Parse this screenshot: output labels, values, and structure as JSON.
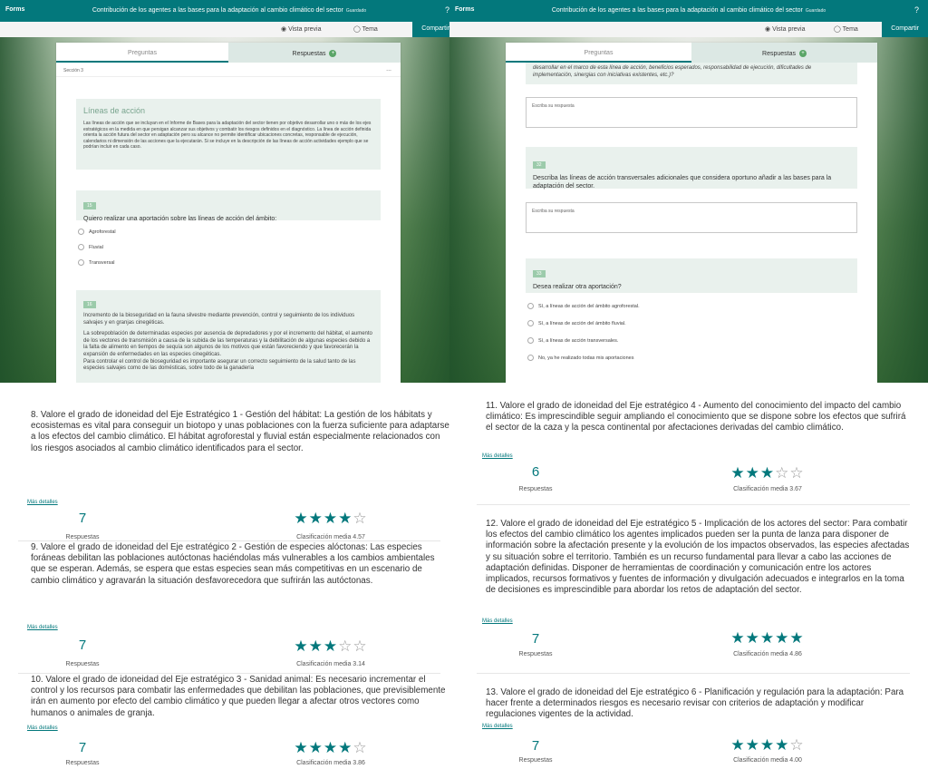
{
  "left_pane": {
    "topbar": {
      "brand": "Forms",
      "title": "Contribución de los agentes a las bases para la adaptación al cambio climático del sector",
      "status": "Guardado",
      "help": "?"
    },
    "subbar": {
      "preview": "Vista previa",
      "theme": "Tema",
      "share": "Compartir"
    },
    "tabs": {
      "questions": "Preguntas",
      "responses": "Respuestas"
    },
    "section": {
      "label": "Sección 3",
      "menu": "..."
    },
    "intro": {
      "title": "Líneas de acción",
      "text": "Las líneas de acción que se incluyan en el Informe de Bases para la adaptación del sector tienen por objetivo desarrollar uno o más de los ejes estratégicos en la medida en que persigan alcanzar sus objetivos y combatir los riesgos definidos en el diagnóstico. La línea de acción definida orienta la acción futura del sector en adaptación pero su alcance no permite identificar ubicaciones concretas, responsable de ejecución, calendarios ni dimensión de las acciones que la ejecutarán. Si se incluye en la descripción de las líneas de acción actividades ejemplo que se podrían incluir en cada caso."
    },
    "q15": {
      "num": "15",
      "text": "Quiero realizar una aportación sobre las líneas de acción del ámbito:",
      "options": [
        "Agroforestal",
        "Fluvial",
        "Transversal"
      ]
    },
    "q16": {
      "num": "16",
      "text": "Incremento de la bioseguridad en la fauna silvestre mediante prevención, control y seguimiento de los individuos salvajes y en granjas cinegéticas.",
      "p1": "La sobrepoblación de determinadas especies por ausencia de depredadores y por el incremento del hábitat, el aumento de los vectores de transmisión a causa de la subida de las temperaturas y la debilitación de algunas especies debido a la falta de alimento en tiempos de sequía son algunos de los motivos que están favoreciendo y que favorecerán la expansión de enfermedades en las especies cinegéticas.",
      "p2": "Para controlar el control de bioseguridad es importante asegurar un correcto seguimiento de la salud tanto de las especies salvajes como de las domésticas, sobre todo de la ganadería"
    }
  },
  "right_pane": {
    "topbar": {
      "brand": "Forms",
      "title": "Contribución de los agentes a las bases para la adaptación al cambio climático del sector",
      "status": "Guardado",
      "help": "?"
    },
    "subbar": {
      "preview": "Vista previa",
      "theme": "Tema",
      "share": "Compartir"
    },
    "tabs": {
      "questions": "Preguntas",
      "responses": "Respuestas"
    },
    "q31_tail": "desarrollar en el marco de esta línea de acción, beneficios esperados, responsabilidad de ejecución, dificultades de implementación, sinergias con iniciativas existentes, etc.)?",
    "answer_placeholder": "Escriba su respuesta",
    "q32": {
      "num": "32",
      "text": "Describa las líneas de acción transversales adicionales que considera oportuno añadir a las bases para la adaptación del sector."
    },
    "q33": {
      "num": "33",
      "text": "Desea realizar otra aportación?",
      "options": [
        "Sí, a líneas de acción del ámbito agroforestal.",
        "Sí, a líneas de acción del ámbito fluvial.",
        "Sí, a líneas de acción transversales.",
        "No, ya he realizado todas mis aportaciones"
      ]
    }
  },
  "results_left": [
    {
      "text": "8. Valore el grado de idoneidad del Eje Estratégico 1 - Gestión del hábitat: La gestión de los hábitats y ecosistemas es vital para conseguir un biotopo y unas poblaciones con la fuerza suficiente para adaptarse a los efectos del cambio climático. El hábitat agroforestal y fluvial están especialmente relacionados con los riesgos asociados al cambio climático identificados para el sector.",
      "more": "Más detalles",
      "responses": "7",
      "responses_label": "Respuestas",
      "rating": 4.57,
      "rating_label": "Clasificación media 4.57"
    },
    {
      "text": "9. Valore el grado de idoneidad del Eje estratégico 2 - Gestión de especies alóctonas: Las especies foráneas debilitan las poblaciones autóctonas haciéndolas más vulnerables a los cambios ambientales que se esperan. Además, se espera que estas especies sean más competitivas en un escenario de cambio climático y agravarán la situación desfavorecedora que sufrirán las autóctonas.",
      "more": "Más detalles",
      "responses": "7",
      "responses_label": "Respuestas",
      "rating": 3.14,
      "rating_label": "Clasificación media 3.14"
    },
    {
      "text": "10. Valore el grado de idoneidad del Eje estratégico 3 - Sanidad animal: Es necesario incrementar el control y los recursos para combatir las enfermedades que debilitan las poblaciones, que previsiblemente irán en aumento por efecto del cambio climático y que pueden llegar a afectar otros vectores como humanos o animales de granja.",
      "more": "Más detalles",
      "responses": "7",
      "responses_label": "Respuestas",
      "rating": 3.86,
      "rating_label": "Clasificación media 3.86"
    }
  ],
  "results_right": [
    {
      "text": "11. Valore el grado de idoneidad del Eje estratégico 4 - Aumento del conocimiento del impacto del cambio climático: Es imprescindible seguir ampliando el conocimiento que se dispone sobre los efectos que sufrirá el sector de la caza y la pesca continental por afectaciones derivadas del cambio climático.",
      "more": "Más detalles",
      "responses": "6",
      "responses_label": "Respuestas",
      "rating": 3.67,
      "rating_label": "Clasificación media 3.67"
    },
    {
      "text": "12. Valore el grado de idoneidad del Eje estratégico 5 - Implicación de los actores del sector: Para combatir los efectos del cambio climático los agentes implicados pueden ser la punta de lanza para disponer de información sobre la afectación presente y la evolución de los impactos observados, las especies afectadas y su situación sobre el territorio. También es un recurso fundamental para llevar a cabo las acciones de adaptación definidas. Disponer de herramientas de coordinación y comunicación entre los actores implicados, recursos formativos y fuentes de información y divulgación adecuados e integrarlos en la toma de decisiones es imprescindible para abordar los retos de adaptación del sector.",
      "more": "Más detalles",
      "responses": "7",
      "responses_label": "Respuestas",
      "rating": 4.86,
      "rating_label": "Clasificación media 4.86"
    },
    {
      "text": "13. Valore el grado de idoneidad del Eje estratégico 6 - Planificación y regulación para la adaptación: Para hacer frente a determinados riesgos es necesario revisar con criterios de adaptación y modificar regulaciones vigentes de la actividad.",
      "more": "Más detalles",
      "responses": "7",
      "responses_label": "Respuestas",
      "rating": 4.0,
      "rating_label": "Clasificación media 4.00"
    }
  ],
  "colors": {
    "accent": "#03787c",
    "panel": "#e9f1ed",
    "badge": "#5aa567"
  },
  "icons": {
    "preview": "eye-icon",
    "theme": "palette-icon",
    "star": "star-icon"
  }
}
